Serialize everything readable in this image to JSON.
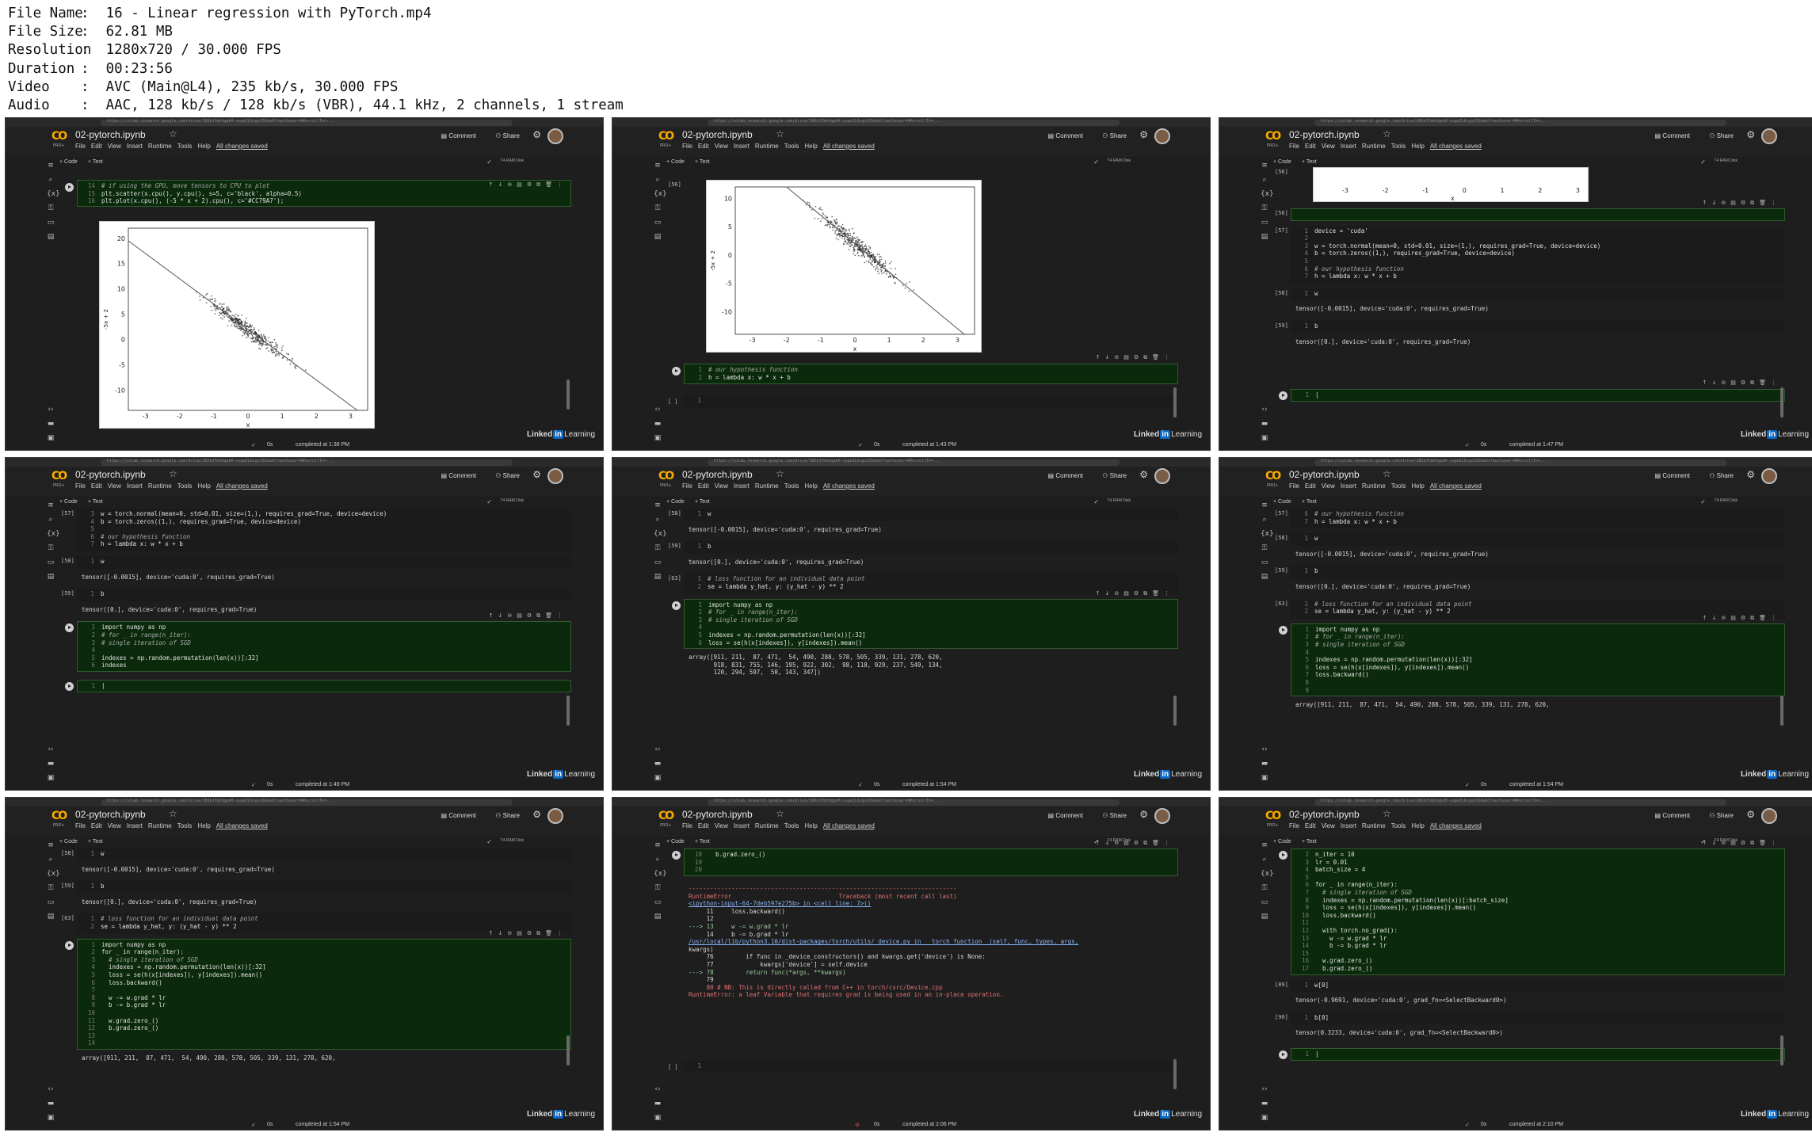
{
  "meta": [
    {
      "label": "File Name",
      "value": "16 - Linear regression with PyTorch.mp4"
    },
    {
      "label": "File Size",
      "value": "62.81 MB"
    },
    {
      "label": "Resolution",
      "value": "1280x720 / 30.000 FPS"
    },
    {
      "label": "Duration",
      "value": "00:23:56"
    },
    {
      "label": "Video",
      "value": "AVC (Main@L4), 235 kb/s, 30.000 FPS"
    },
    {
      "label": "Audio",
      "value": "AAC, 128 kb/s / 128 kb/s (VBR), 44.1 kHz, 2 channels, 1 stream"
    }
  ],
  "colab": {
    "url": "https://colab.research.google.com/drive/1BXbJYmhSqpkH-sugeZL6zgsVZGdaXt?authuser=0#scrollTo=...",
    "title": "02-pytorch.ipynb",
    "star": "☆",
    "menus": [
      "File",
      "Edit",
      "View",
      "Insert",
      "Runtime",
      "Tools",
      "Help"
    ],
    "saved": "All changes saved",
    "comment": "Comment",
    "share": "Share",
    "code_btn": "+ Code",
    "text_btn": "+ Text",
    "ram": "RAM",
    "disk": "Disk",
    "t4": "T4",
    "pro": "PRO+",
    "brand_linked": "Linked",
    "brand_in": "in",
    "brand_learning": "Learning",
    "zero_s": "0s"
  },
  "tiles": [
    {
      "completed": "completed at 1:38 PM",
      "code": [
        {
          "ln": "14",
          "t": "# if using the GPU, move tensors to CPU to plot",
          "c": "cm"
        },
        {
          "ln": "15",
          "t": "plt.scatter(x.cpu(), y.cpu(), s=5, c='black', alpha=0.5)"
        },
        {
          "ln": "16",
          "t": "plt.plot(x.cpu(), (-5 * x + 2).cpu(), c='#CC79A7');"
        }
      ],
      "plot": {
        "ylabel": "-5x + 2",
        "xlabel": "x",
        "yticks": [
          "20",
          "15",
          "10",
          "5",
          "0",
          "-5",
          "-10"
        ],
        "xticks": [
          "-3",
          "-2",
          "-1",
          "0",
          "1",
          "2",
          "3"
        ]
      }
    },
    {
      "completed": "completed at 1:43 PM",
      "exec_num": "[56]",
      "code": [
        {
          "ln": "1",
          "t": "# our hypothesis function",
          "c": "cm"
        },
        {
          "ln": "2",
          "t": "h = lambda x: w * x + b"
        }
      ],
      "empty_cell": "[ ]",
      "plot": {
        "ylabel": "-5x + 2",
        "xlabel": "x",
        "yticks": [
          "10",
          "5",
          "0",
          "-5",
          "-10"
        ],
        "xticks": [
          "-3",
          "-2",
          "-1",
          "0",
          "1",
          "2",
          "3"
        ]
      }
    },
    {
      "completed": "completed at 1:47 PM",
      "cells": [
        {
          "num": "[56]",
          "lines": []
        },
        {
          "num": "[57]",
          "lines": [
            {
              "ln": "1",
              "t": "device = 'cuda'"
            },
            {
              "ln": "2",
              "t": ""
            },
            {
              "ln": "3",
              "t": "w = torch.normal(mean=0, std=0.01, size=(1,), requires_grad=True, device=device)"
            },
            {
              "ln": "4",
              "t": "b = torch.zeros((1,), requires_grad=True, device=device)"
            },
            {
              "ln": "5",
              "t": ""
            },
            {
              "ln": "6",
              "t": "# our hypothesis function",
              "c": "cm"
            },
            {
              "ln": "7",
              "t": "h = lambda x: w * x + b"
            }
          ]
        },
        {
          "num": "[58]",
          "lines": [
            {
              "ln": "1",
              "t": "w"
            }
          ],
          "out": "tensor([-0.0015], device='cuda:0', requires_grad=True)"
        },
        {
          "num": "[59]",
          "lines": [
            {
              "ln": "1",
              "t": "b"
            }
          ],
          "out": "tensor([0.], device='cuda:0', requires_grad=True)"
        }
      ],
      "xticks": [
        "-3",
        "-2",
        "-1",
        "0",
        "1",
        "2",
        "3"
      ],
      "xlabel": "x"
    },
    {
      "completed": "completed at 1:49 PM",
      "cells": [
        {
          "num": "[57]",
          "lines": [
            {
              "ln": "3",
              "t": "w = torch.normal(mean=0, std=0.01, size=(1,), requires_grad=True, device=device)"
            },
            {
              "ln": "4",
              "t": "b = torch.zeros((1,), requires_grad=True, device=device)"
            },
            {
              "ln": "5",
              "t": ""
            },
            {
              "ln": "6",
              "t": "# our hypothesis function",
              "c": "cm"
            },
            {
              "ln": "7",
              "t": "h = lambda x: w * x + b"
            }
          ]
        },
        {
          "num": "[58]",
          "lines": [
            {
              "ln": "1",
              "t": "w"
            }
          ],
          "out": "tensor([-0.0015], device='cuda:0', requires_grad=True)"
        },
        {
          "num": "[59]",
          "lines": [
            {
              "ln": "1",
              "t": "b"
            }
          ],
          "out": "tensor([0.], device='cuda:0', requires_grad=True)"
        },
        {
          "num": "",
          "lines": [
            {
              "ln": "1",
              "t": "import numpy as np"
            },
            {
              "ln": "2",
              "t": "# for _ in range(n_iter):",
              "c": "cm"
            },
            {
              "ln": "3",
              "t": "# single iteration of SGD",
              "c": "cm"
            },
            {
              "ln": "4",
              "t": ""
            },
            {
              "ln": "5",
              "t": "indexes = np.random.permutation(len(x))[:32]"
            },
            {
              "ln": "6",
              "t": "indexes"
            }
          ]
        }
      ]
    },
    {
      "completed": "completed at 1:54 PM",
      "cells": [
        {
          "num": "[58]",
          "lines": [
            {
              "ln": "1",
              "t": "w"
            }
          ],
          "out": "tensor([-0.0015], device='cuda:0', requires_grad=True)"
        },
        {
          "num": "[59]",
          "lines": [
            {
              "ln": "1",
              "t": "b"
            }
          ],
          "out": "tensor([0.], device='cuda:0', requires_grad=True)"
        },
        {
          "num": "[63]",
          "lines": [
            {
              "ln": "1",
              "t": "# loss function for an individual data point",
              "c": "cm"
            },
            {
              "ln": "2",
              "t": "se = lambda y_hat, y: (y_hat - y) ** 2"
            }
          ]
        },
        {
          "num": "",
          "lines": [
            {
              "ln": "1",
              "t": "import numpy as np"
            },
            {
              "ln": "2",
              "t": "# for _ in range(n_iter):",
              "c": "cm"
            },
            {
              "ln": "3",
              "t": "# single iteration of SGD",
              "c": "cm"
            },
            {
              "ln": "4",
              "t": ""
            },
            {
              "ln": "5",
              "t": "indexes = np.random.permutation(len(x))[:32]"
            },
            {
              "ln": "6",
              "t": "loss = se(h(x[indexes]), y[indexes]).mean()"
            }
          ],
          "out": "array([911, 211,  87, 471,  54, 490, 288, 578, 505, 339, 131, 278, 620,\n       918, 831, 755, 146, 195, 922, 302,  98, 118, 929, 237, 549, 134,\n       120, 294, 597,  50, 143, 347])"
        }
      ]
    },
    {
      "completed": "completed at 1:54 PM",
      "cells": [
        {
          "num": "[57]",
          "lines": [
            {
              "ln": "6",
              "t": "# our hypothesis function",
              "c": "cm"
            },
            {
              "ln": "7",
              "t": "h = lambda x: w * x + b"
            }
          ]
        },
        {
          "num": "[58]",
          "lines": [
            {
              "ln": "1",
              "t": "w"
            }
          ],
          "out": "tensor([-0.0015], device='cuda:0', requires_grad=True)"
        },
        {
          "num": "[59]",
          "lines": [
            {
              "ln": "1",
              "t": "b"
            }
          ],
          "out": "tensor([0.], device='cuda:0', requires_grad=True)"
        },
        {
          "num": "[63]",
          "lines": [
            {
              "ln": "1",
              "t": "# loss function for an individual data point",
              "c": "cm"
            },
            {
              "ln": "2",
              "t": "se = lambda y_hat, y: (y_hat - y) ** 2"
            }
          ]
        },
        {
          "num": "",
          "lines": [
            {
              "ln": "1",
              "t": "import numpy as np"
            },
            {
              "ln": "2",
              "t": "# for _ in range(n_iter):",
              "c": "cm"
            },
            {
              "ln": "3",
              "t": "# single iteration of SGD",
              "c": "cm"
            },
            {
              "ln": "4",
              "t": ""
            },
            {
              "ln": "5",
              "t": "indexes = np.random.permutation(len(x))[:32]"
            },
            {
              "ln": "6",
              "t": "loss = se(h(x[indexes]), y[indexes]).mean()"
            },
            {
              "ln": "7",
              "t": "loss.backward()"
            },
            {
              "ln": "8",
              "t": ""
            },
            {
              "ln": "9",
              "t": ""
            }
          ],
          "out": "array([911, 211,  87, 471,  54, 490, 288, 578, 505, 339, 131, 278, 620,"
        }
      ]
    },
    {
      "completed": "completed at 1:54 PM",
      "cells": [
        {
          "num": "[58]",
          "lines": [
            {
              "ln": "1",
              "t": "w"
            }
          ],
          "out": "tensor([-0.0015], device='cuda:0', requires_grad=True)"
        },
        {
          "num": "[59]",
          "lines": [
            {
              "ln": "1",
              "t": "b"
            }
          ],
          "out": "tensor([0.], device='cuda:0', requires_grad=True)"
        },
        {
          "num": "[63]",
          "lines": [
            {
              "ln": "1",
              "t": "# loss function for an individual data point",
              "c": "cm"
            },
            {
              "ln": "2",
              "t": "se = lambda y_hat, y: (y_hat - y) ** 2"
            }
          ]
        },
        {
          "num": "",
          "lines": [
            {
              "ln": "1",
              "t": "import numpy as np"
            },
            {
              "ln": "2",
              "t": "for _ in range(n_iter):"
            },
            {
              "ln": "3",
              "t": "  # single iteration of SGD",
              "c": "cm"
            },
            {
              "ln": "4",
              "t": "  indexes = np.random.permutation(len(x))[:32]"
            },
            {
              "ln": "5",
              "t": "  loss = se(h(x[indexes]), y[indexes]).mean()"
            },
            {
              "ln": "6",
              "t": "  loss.backward()"
            },
            {
              "ln": "7",
              "t": ""
            },
            {
              "ln": "8",
              "t": "  w -= w.grad * lr"
            },
            {
              "ln": "9",
              "t": "  b -= b.grad * lr"
            },
            {
              "ln": "10",
              "t": ""
            },
            {
              "ln": "11",
              "t": "  w.grad.zero_()"
            },
            {
              "ln": "12",
              "t": "  b.grad.zero_()"
            },
            {
              "ln": "13",
              "t": ""
            },
            {
              "ln": "14",
              "t": ""
            }
          ],
          "out": "array([911, 211,  87, 471,  54, 490, 288, 578, 505, 339, 131, 278, 620,"
        }
      ]
    },
    {
      "completed": "completed at 2:06 PM",
      "cells": [
        {
          "num": "",
          "lines": [
            {
              "ln": "18",
              "t": "  b.grad.zero_()"
            },
            {
              "ln": "19",
              "t": ""
            },
            {
              "ln": "20",
              "t": ""
            }
          ]
        }
      ],
      "traceback": [
        {
          "t": "---------------------------------------------------------------------------",
          "c": "red"
        },
        {
          "t": "RuntimeError                              Traceback (most recent call last)",
          "c": "red"
        },
        {
          "t": "<ipython-input-64-7deb597e275b> in <cell line: 7>()",
          "c": "lnk"
        },
        {
          "t": "     11     loss.backward()"
        },
        {
          "t": "     12"
        },
        {
          "t": "---> 13     w -= w.grad * lr",
          "c": "grn"
        },
        {
          "t": "     14     b -= b.grad * lr"
        },
        {
          "t": ""
        },
        {
          "t": "/usr/local/lib/python3.10/dist-packages/torch/utils/_device.py in __torch_function__(self, func, types, args,",
          "c": "lnk"
        },
        {
          "t": "kwargs)"
        },
        {
          "t": "     76         if func in _device_constructors() and kwargs.get('device') is None:"
        },
        {
          "t": "     77             kwargs['device'] = self.device"
        },
        {
          "t": "---> 78         return func(*args, **kwargs)",
          "c": "grn"
        },
        {
          "t": "     79"
        },
        {
          "t": "     80 # NB: This is directly called from C++ in torch/csrc/Device.cpp",
          "c": "red"
        },
        {
          "t": ""
        },
        {
          "t": "RuntimeError: a leaf Variable that requires grad is being used in an in-place operation.",
          "c": "red"
        }
      ]
    },
    {
      "completed": "completed at 2:10 PM",
      "cells": [
        {
          "num": "",
          "lines": [
            {
              "ln": "2",
              "t": "n_iter = 10"
            },
            {
              "ln": "3",
              "t": "lr = 0.01"
            },
            {
              "ln": "4",
              "t": "batch_size = 4"
            },
            {
              "ln": "5",
              "t": ""
            },
            {
              "ln": "6",
              "t": "for _ in range(n_iter):"
            },
            {
              "ln": "7",
              "t": "  # single iteration of SGD",
              "c": "cm"
            },
            {
              "ln": "8",
              "t": "  indexes = np.random.permutation(len(x))[:batch_size]"
            },
            {
              "ln": "9",
              "t": "  loss = se(h(x[indexes]), y[indexes]).mean()"
            },
            {
              "ln": "10",
              "t": "  loss.backward()"
            },
            {
              "ln": "11",
              "t": ""
            },
            {
              "ln": "12",
              "t": "  with torch.no_grad():"
            },
            {
              "ln": "13",
              "t": "    w -= w.grad * lr"
            },
            {
              "ln": "14",
              "t": "    b -= b.grad * lr"
            },
            {
              "ln": "15",
              "t": ""
            },
            {
              "ln": "16",
              "t": "  w.grad.zero_()"
            },
            {
              "ln": "17",
              "t": "  b.grad.zero_()"
            }
          ]
        },
        {
          "num": "[89]",
          "lines": [
            {
              "ln": "1",
              "t": "w[0]"
            }
          ],
          "out": "tensor(-0.9691, device='cuda:0', grad_fn=<SelectBackward0>)"
        },
        {
          "num": "[90]",
          "lines": [
            {
              "ln": "1",
              "t": "b[0]"
            }
          ],
          "out": "tensor(0.3233, device='cuda:0', grad_fn=<SelectBackward0>)"
        }
      ]
    }
  ]
}
